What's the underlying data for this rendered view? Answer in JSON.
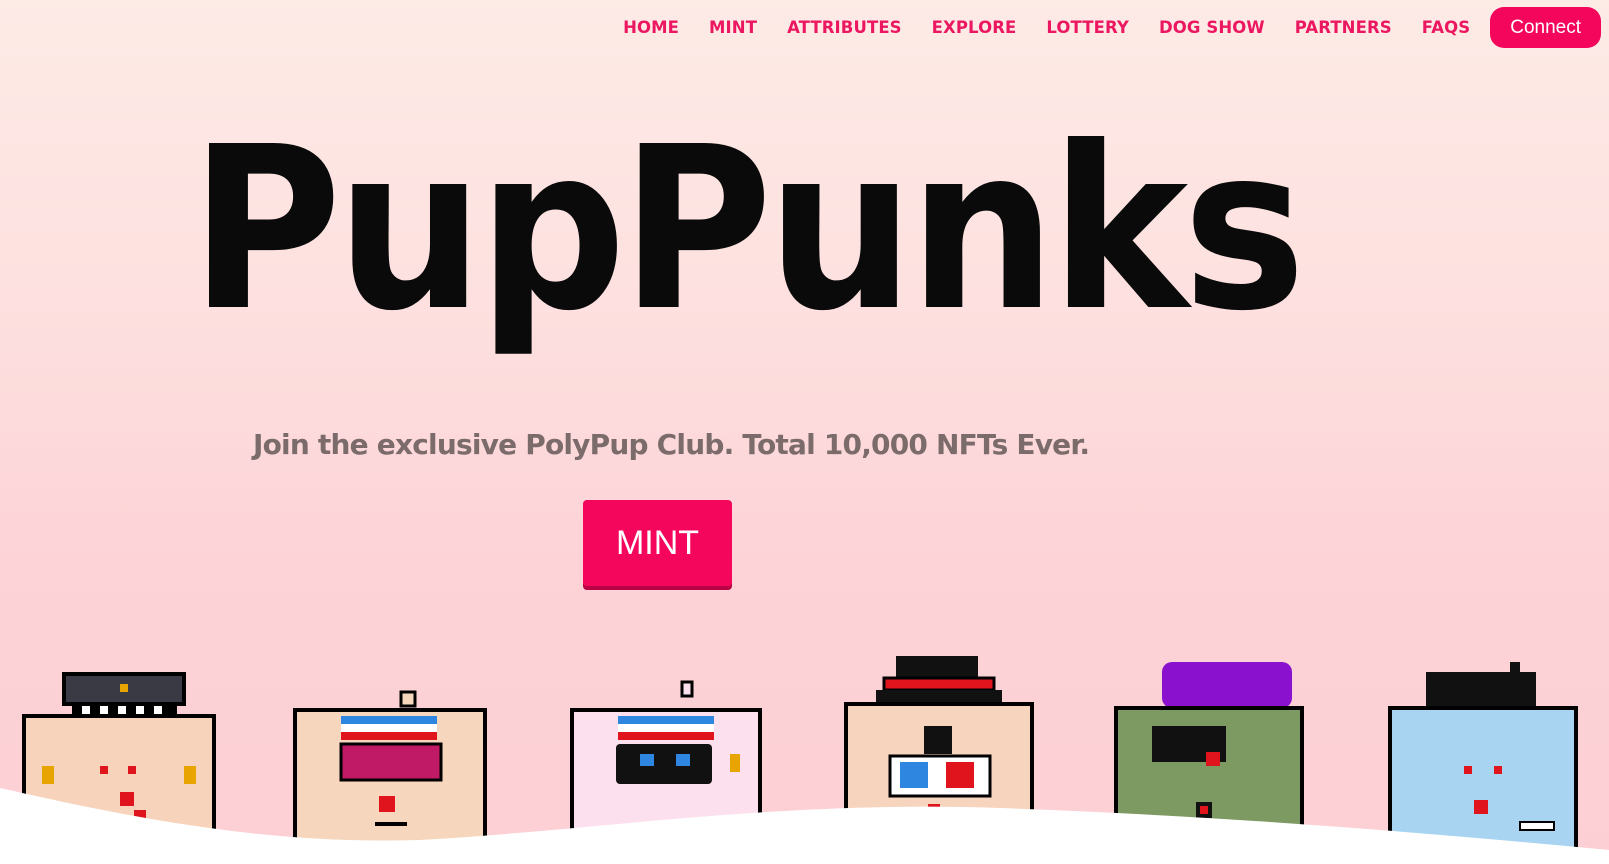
{
  "nav": {
    "items": [
      "HOME",
      "MINT",
      "ATTRIBUTES",
      "EXPLORE",
      "LOTTERY",
      "DOG SHOW",
      "PARTNERS",
      "FAQS"
    ],
    "connect_label": "Connect"
  },
  "hero": {
    "title": "PupPunks",
    "tagline": "Join the exclusive PolyPup Club. Total 10,000 NFTs Ever.",
    "mint_label": "MINT"
  },
  "colors": {
    "accent": "#f3065c",
    "nav_text": "#ec1761",
    "title": "#0a0a0a",
    "tagline": "#7b6b6b"
  },
  "pups": [
    {
      "name": "pup-police-hat",
      "skin": "#f7d3bb",
      "hat": "#3a3a44"
    },
    {
      "name": "pup-headband-glasses",
      "skin": "#f6d7bd",
      "accessory": "#c01a66"
    },
    {
      "name": "pup-headband-goggles",
      "skin": "#fde0ee",
      "accessory": "#111111"
    },
    {
      "name": "pup-top-hat-3d-glasses",
      "skin": "#f7d4bd",
      "hat": "#111111"
    },
    {
      "name": "pup-purple-beret",
      "skin": "#7d9a62",
      "hat": "#8a12cf"
    },
    {
      "name": "pup-blue-spiky",
      "skin": "#a8d4f1",
      "hat": "#111111"
    }
  ]
}
